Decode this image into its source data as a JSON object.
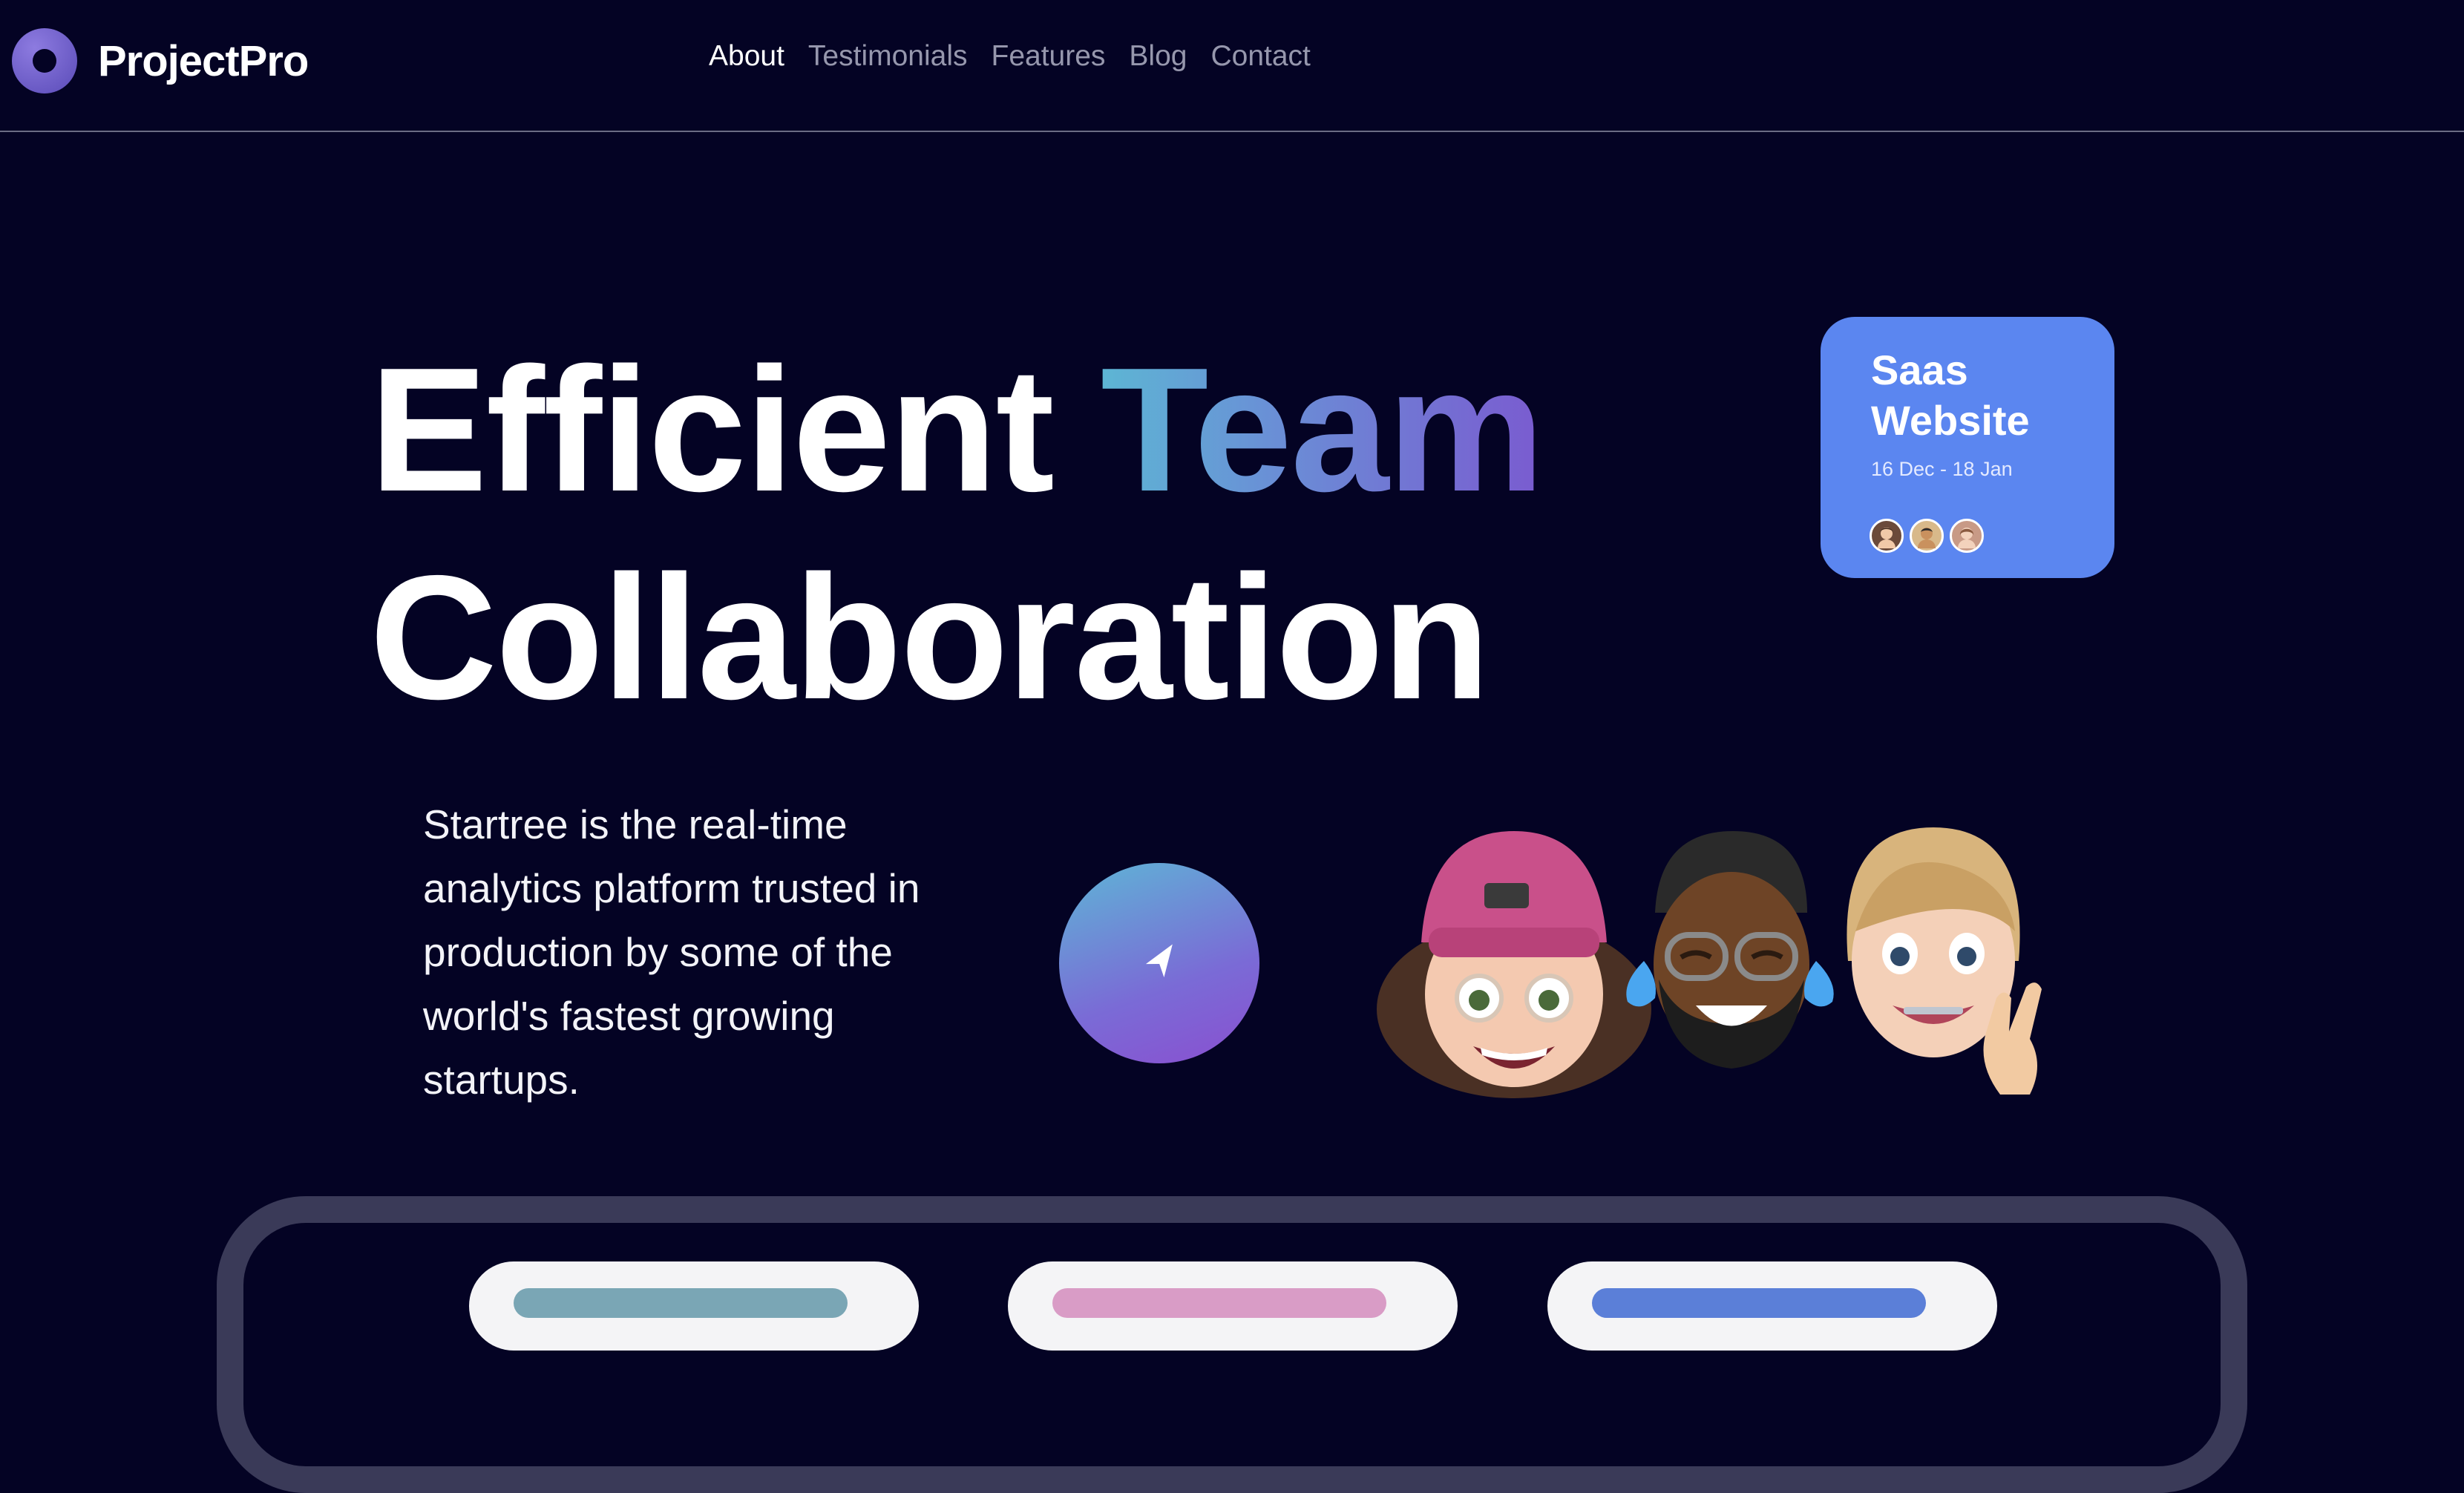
{
  "header": {
    "brand": "ProjectPro",
    "nav": [
      {
        "label": "About",
        "active": true
      },
      {
        "label": "Testimonials",
        "active": false
      },
      {
        "label": "Features",
        "active": false
      },
      {
        "label": "Blog",
        "active": false
      },
      {
        "label": "Contact",
        "active": false
      }
    ]
  },
  "hero": {
    "headline_word1": "Efficient",
    "headline_word2": "Team",
    "headline_line2": "Collaboration",
    "description": "Startree is the real-time analytics platform trusted in production by some of the world's fastest growing startups."
  },
  "project_card": {
    "title_line1": "Saas",
    "title_line2": "Website",
    "date_range": "16 Dec - 18 Jan",
    "avatars": [
      "avatar-woman-icon",
      "avatar-man-icon",
      "avatar-woman-2-icon"
    ]
  },
  "cta_icon": "navigation-arrow-icon",
  "colors": {
    "background": "#040324",
    "card_blue": "#5b86f0",
    "gradient_start": "#5db6d4",
    "gradient_end": "#7a5bd0",
    "nav_inactive": "#9697ad",
    "panel_border": "#3a3a58"
  },
  "mini_cards": [
    {
      "strip_color": "#7aa6b5"
    },
    {
      "strip_color": "#d99cc6"
    },
    {
      "strip_color": "#5b7fd8"
    }
  ]
}
